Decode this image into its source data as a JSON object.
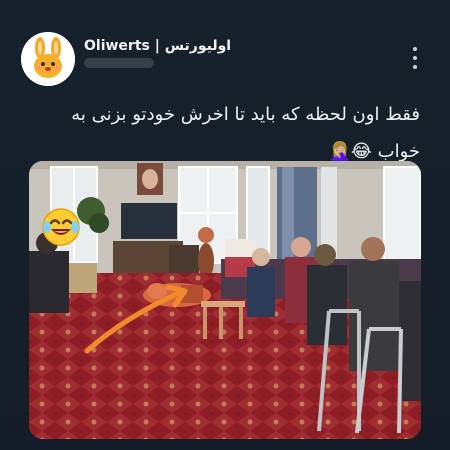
{
  "tweet": {
    "author_name": "Oliwerts | اولیورتس",
    "text": "فقط اون لحظه که باید تا اخرش خودتو بزنی به خواب 😂🤦🏼‍♀️"
  },
  "icons": {
    "avatar": "bunny-avatar-icon",
    "menu": "more-vertical-icon",
    "overlay": "laughing-tears-emoji-icon"
  },
  "media": {
    "alt": "Room with seated elderly women and a person lying on the carpet",
    "accent_arrow_color": "#f08a2b"
  }
}
